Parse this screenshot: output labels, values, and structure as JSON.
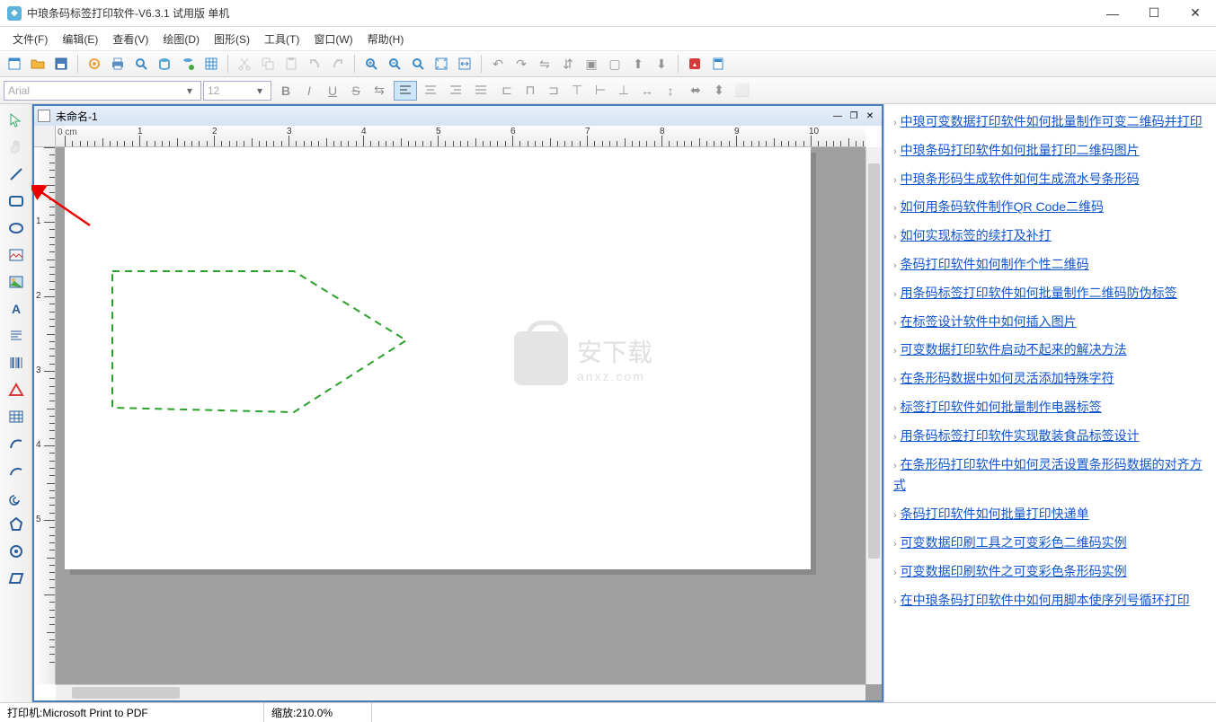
{
  "title": "中琅条码标签打印软件-V6.3.1 试用版 单机",
  "menu": [
    "文件(F)",
    "编辑(E)",
    "查看(V)",
    "绘图(D)",
    "图形(S)",
    "工具(T)",
    "窗口(W)",
    "帮助(H)"
  ],
  "font": {
    "name": "Arial",
    "size": "12"
  },
  "doc": {
    "name": "未命名-1"
  },
  "ruler": {
    "unit": "0 cm",
    "h_major": [
      "1",
      "2",
      "3",
      "4",
      "5",
      "6",
      "7",
      "8",
      "9",
      "10"
    ],
    "v_major": [
      "1",
      "2",
      "3",
      "4",
      "5"
    ]
  },
  "watermark": {
    "cn": "安下载",
    "en": "anxz.com"
  },
  "status": {
    "printer_label": "打印机:",
    "printer": "Microsoft Print to PDF",
    "zoom_label": "缩放:",
    "zoom": "210.0%"
  },
  "help_links": [
    "中琅可变数据打印软件如何批量制作可变二维码并打印",
    "中琅条码打印软件如何批量打印二维码图片",
    "中琅条形码生成软件如何生成流水号条形码",
    "如何用条码软件制作QR Code二维码",
    "如何实现标签的续打及补打",
    "条码打印软件如何制作个性二维码",
    "用条码标签打印软件如何批量制作二维码防伪标签",
    "在标签设计软件中如何插入图片",
    "可变数据打印软件启动不起来的解决方法",
    "在条形码数据中如何灵活添加特殊字符",
    "标签打印软件如何批量制作电器标签",
    "用条码标签打印软件实现散装食品标签设计",
    "在条形码打印软件中如何灵活设置条形码数据的对齐方式",
    "条码打印软件如何批量打印快递单",
    "可变数据印刷工具之可变彩色二维码实例",
    "可变数据印刷软件之可变彩色条形码实例",
    "在中琅条码打印软件中如何用脚本使序列号循环打印"
  ]
}
